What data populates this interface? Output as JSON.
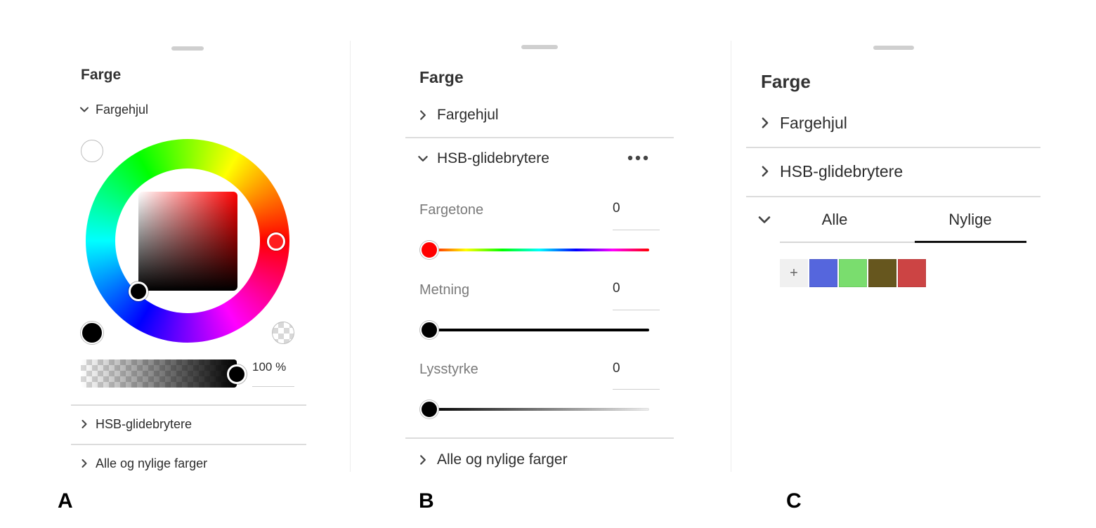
{
  "panels": {
    "a": {
      "letter": "A",
      "title": "Farge",
      "wheel_section": {
        "label": "Fargehjul",
        "expanded": true
      },
      "selected_hue": "#ff0000",
      "foreground_swatch_color": "#000000",
      "background_swatch_color": "#ffffff",
      "opacity_value": "100 %",
      "sections": [
        {
          "label": "HSB-glidebrytere",
          "expanded": false
        },
        {
          "label": "Alle og nylige farger",
          "expanded": false
        }
      ]
    },
    "b": {
      "letter": "B",
      "title": "Farge",
      "sections": [
        {
          "label": "Fargehjul",
          "expanded": false
        },
        {
          "label": "HSB-glidebrytere",
          "expanded": true
        },
        {
          "label": "Alle og nylige farger",
          "expanded": false
        }
      ],
      "more_icon": "more-horizontal-icon",
      "sliders": [
        {
          "label": "Fargetone",
          "value": "0",
          "level": 0
        },
        {
          "label": "Metning",
          "value": "0",
          "level": 0
        },
        {
          "label": "Lysstyrke",
          "value": "0",
          "level": 0
        }
      ]
    },
    "c": {
      "letter": "C",
      "title": "Farge",
      "sections": [
        {
          "label": "Fargehjul",
          "expanded": false
        },
        {
          "label": "HSB-glidebrytere",
          "expanded": false
        }
      ],
      "tabs": [
        {
          "label": "Alle",
          "selected": false
        },
        {
          "label": "Nylige",
          "selected": true
        }
      ],
      "add_label": "+",
      "swatches": [
        "#5566dd",
        "#7add6e",
        "#66561e",
        "#cc4444"
      ]
    }
  },
  "colors": {
    "text": "#323232",
    "divider": "#dcdcdc",
    "selected_tab": "#111111"
  }
}
